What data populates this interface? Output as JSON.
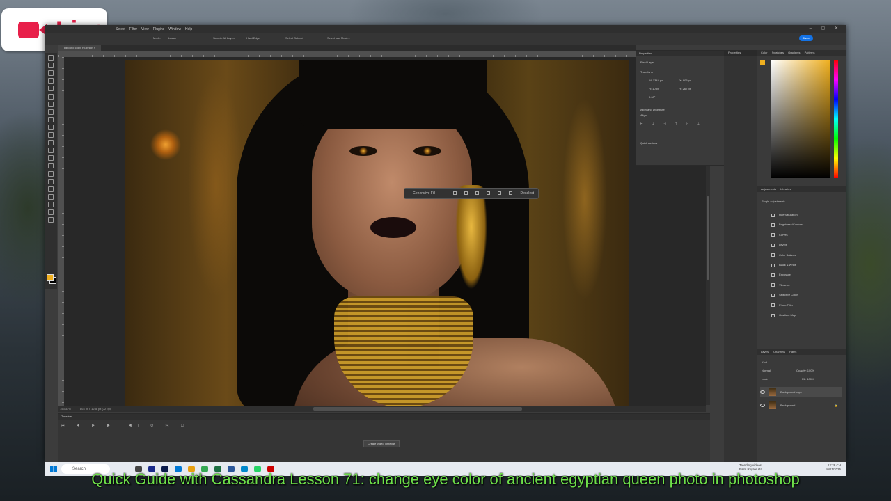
{
  "live": {
    "label": "Live"
  },
  "menu": [
    "Select",
    "Filter",
    "View",
    "Plugins",
    "Window",
    "Help"
  ],
  "options": {
    "mode_label": "Mode:",
    "mode_value": "Lasso",
    "sample_all": "Sample All Layers",
    "hard_edge": "Hard Edge",
    "select_subject": "Select Subject",
    "select_mask": "Select and Mask...",
    "share": "Share"
  },
  "doc_tab": "kground copy, RGB/8#) ×",
  "context_bar": {
    "generative": "Generative Fill",
    "deselect": "Deselect"
  },
  "status": {
    "zoom": "153.33%",
    "size": "803 px x 1238 px (72 ppi)"
  },
  "timeline": {
    "title": "Timeline",
    "create": "Create Video Timeline"
  },
  "properties": {
    "title": "Properties",
    "layer_type": "Pixel Layer",
    "transform": "Transform",
    "w": "W: 1344 px",
    "h": "H: 10 px",
    "x": "X: 805 px",
    "y": "Y: 262 px",
    "angle": "0.00°",
    "align": "Align and Distribute",
    "align_sub": "Align:",
    "quick_actions": "Quick Actions"
  },
  "strip": {
    "properties": "Properties"
  },
  "color_tabs": [
    "Color",
    "Swatches",
    "Gradients",
    "Patterns"
  ],
  "colors": {
    "foreground": "#f0b020",
    "background": "#000000"
  },
  "adjustments": {
    "tabs": [
      "Adjustments",
      "Libraries"
    ],
    "section": "Single adjustments",
    "items": [
      "Hue/Saturation",
      "Brightness/Contrast",
      "Curves",
      "Levels",
      "Color Balance",
      "Black & White",
      "Exposure",
      "Vibrance",
      "Selective Color",
      "Photo Filter",
      "Gradient Map"
    ]
  },
  "layers": {
    "tabs": [
      "Layers",
      "Channels",
      "Paths"
    ],
    "kind": "Kind",
    "blend": "Normal",
    "opacity": "Opacity: 100%",
    "lock": "Lock:",
    "fill": "Fill: 100%",
    "items": [
      "Background copy",
      "Background"
    ]
  },
  "taskbar": {
    "search": "Search",
    "trending": "Trending videos",
    "trending_sub": "Palm Royale sta...",
    "time": "12:28 CH",
    "date": "10/11/2025"
  },
  "caption": "Quick Guide with Cassandra Lesson 71: change eye color of ancient egyptian queen photo in photoshop"
}
